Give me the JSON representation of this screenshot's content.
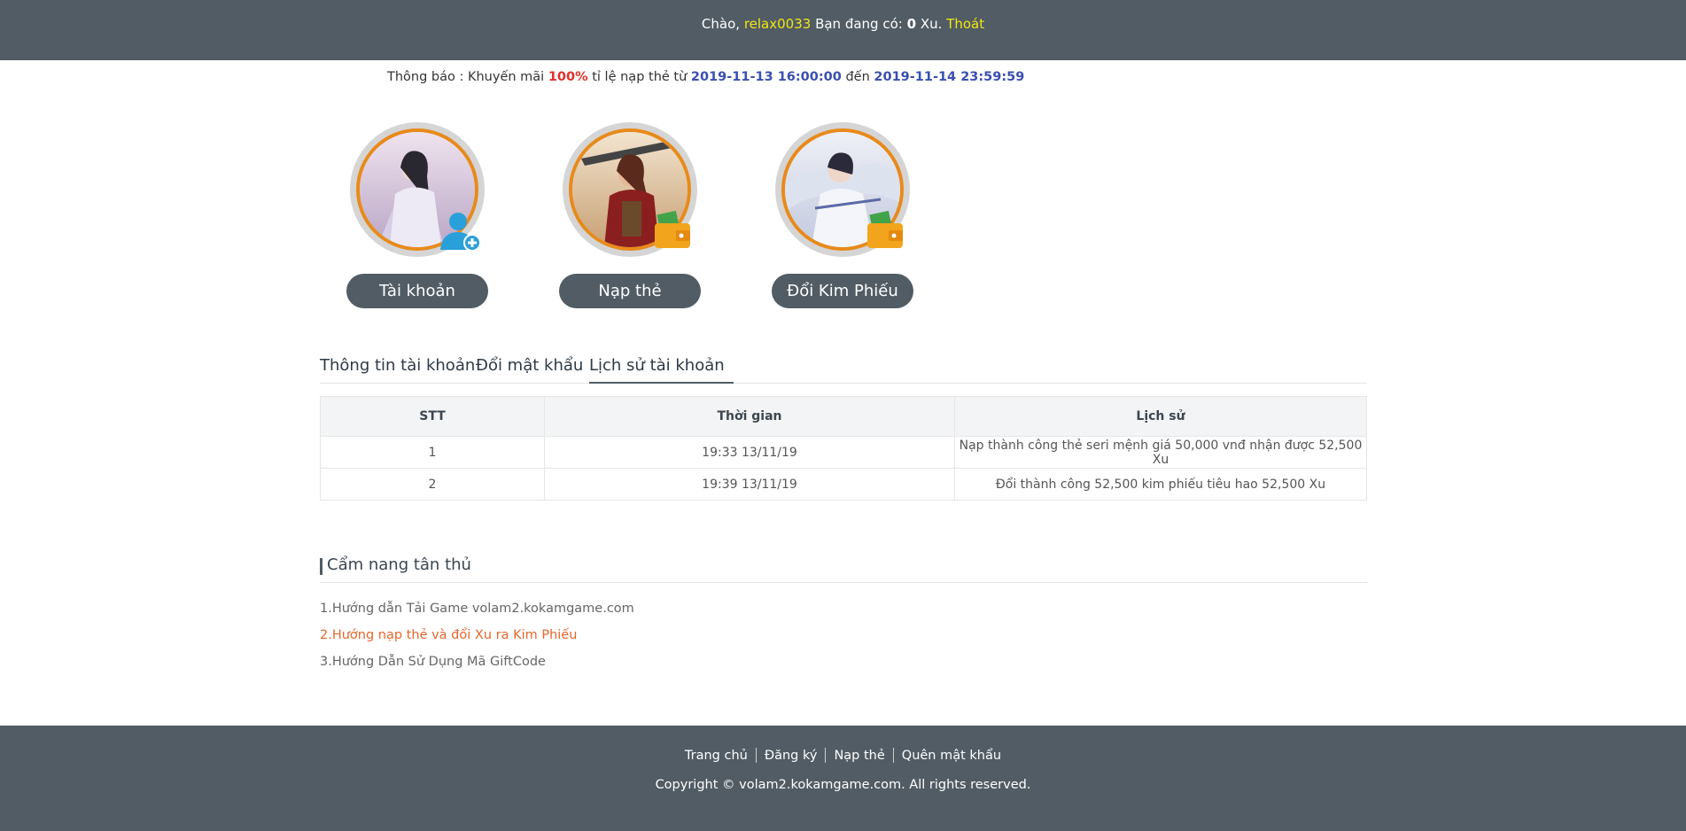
{
  "topbar": {
    "greeting": "Chào,",
    "username": "relax0033",
    "balance_prefix": "Bạn đang có:",
    "balance": "0",
    "currency": "Xu.",
    "logout": "Thoát"
  },
  "notice": {
    "prefix": "Thông báo : Khuyến mãi",
    "percent": "100%",
    "middle": "tỉ lệ nạp thẻ từ",
    "start": "2019-11-13 16:00:00",
    "to": "đến",
    "end": "2019-11-14 23:59:59"
  },
  "cards": [
    {
      "label": "Tài khoản",
      "badge": "add-user-icon"
    },
    {
      "label": "Nạp thẻ",
      "badge": "wallet-icon"
    },
    {
      "label": "Đổi Kim Phiếu",
      "badge": "wallet-icon"
    }
  ],
  "tabs": [
    {
      "label": "Thông tin tài khoản"
    },
    {
      "label": "Đổi mật khẩu"
    },
    {
      "label": "Lịch sử tài khoản"
    }
  ],
  "history": {
    "headers": [
      "STT",
      "Thời gian",
      "Lịch sử"
    ],
    "rows": [
      [
        "1",
        "19:33 13/11/19",
        "Nạp thành công thẻ seri mệnh giá 50,000 vnđ nhận được 52,500 Xu"
      ],
      [
        "2",
        "19:39 13/11/19",
        "Đổi thành công 52,500 kim phiếu tiêu hao 52,500 Xu"
      ]
    ]
  },
  "guide": {
    "title": "Cẩm nang tân thủ",
    "items": [
      "1.Hướng dẫn Tải Game volam2.kokamgame.com",
      "2.Hướng nạp thẻ và đổi Xu ra Kim Phiếu",
      "3.Hướng Dẫn Sử Dụng Mã GiftCode"
    ]
  },
  "footer": {
    "links": [
      "Trang chủ",
      "Đăng ký",
      "Nạp thẻ",
      "Quên mật khẩu"
    ],
    "copyright": "Copyright © volam2.kokamgame.com. All rights reserved."
  },
  "colors": {
    "bar": "#515c64",
    "highlight": "#f3e615",
    "ring": "#e88a1a",
    "promo": "#e0322b",
    "date": "#3a4fb0"
  }
}
